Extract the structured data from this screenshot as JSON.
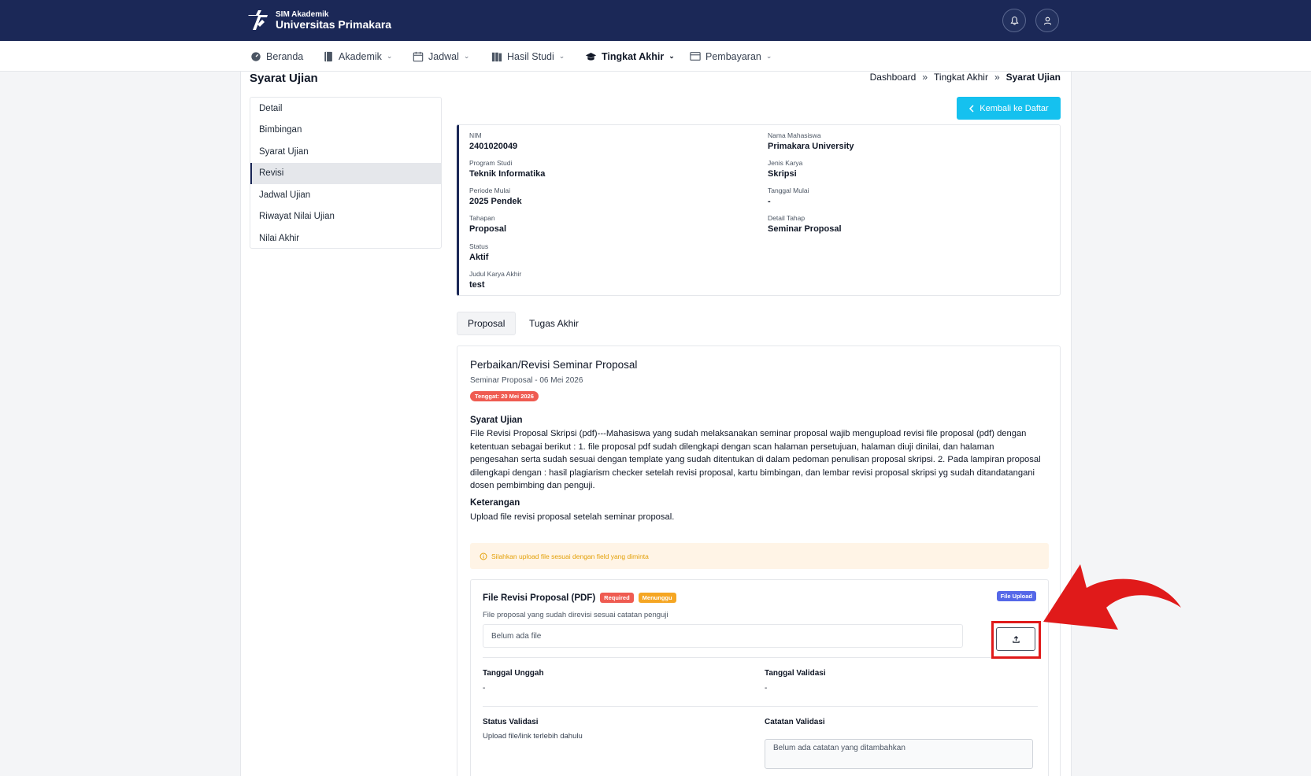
{
  "brand": {
    "subtitle": "SIM Akademik",
    "title": "Universitas Primakara"
  },
  "header_icons": [
    "bell-icon",
    "user-icon"
  ],
  "nav": [
    {
      "label": "Beranda",
      "icon": "dashboard-icon",
      "dropdown": false
    },
    {
      "label": "Akademik",
      "icon": "book-icon",
      "dropdown": true
    },
    {
      "label": "Jadwal",
      "icon": "calendar-icon",
      "dropdown": true
    },
    {
      "label": "Hasil Studi",
      "icon": "books-icon",
      "dropdown": true
    },
    {
      "label": "Tingkat Akhir",
      "icon": "graduation-cap-icon",
      "dropdown": true,
      "active": true
    },
    {
      "label": "Pembayaran",
      "icon": "wallet-icon",
      "dropdown": true
    }
  ],
  "page": {
    "title": "Syarat Ujian",
    "breadcrumb": [
      "Dashboard",
      "Tingkat Akhir",
      "Syarat Ujian"
    ],
    "breadcrumb_sep": "»",
    "back_button": "Kembali ke Daftar"
  },
  "side_menu": [
    "Detail",
    "Bimbingan",
    "Syarat Ujian",
    "Revisi",
    "Jadwal Ujian",
    "Riwayat Nilai Ujian",
    "Nilai Akhir"
  ],
  "side_menu_active": "Revisi",
  "info": {
    "nim": {
      "label": "NIM",
      "value": "2401020049"
    },
    "nama": {
      "label": "Nama Mahasiswa",
      "value": "Primakara University"
    },
    "prodi": {
      "label": "Program Studi",
      "value": "Teknik Informatika"
    },
    "jenis": {
      "label": "Jenis Karya",
      "value": "Skripsi"
    },
    "periode": {
      "label": "Periode Mulai",
      "value": "2025 Pendek"
    },
    "tanggal_mulai": {
      "label": "Tanggal Mulai",
      "value": "-"
    },
    "tahapan": {
      "label": "Tahapan",
      "value": "Proposal"
    },
    "detail_tahap": {
      "label": "Detail Tahap",
      "value": "Seminar Proposal"
    },
    "status": {
      "label": "Status",
      "value": "Aktif"
    },
    "judul": {
      "label": "Judul Karya Akhir",
      "value": "test"
    }
  },
  "tabs": [
    "Proposal",
    "Tugas Akhir"
  ],
  "active_tab": "Proposal",
  "revisi": {
    "title": "Perbaikan/Revisi Seminar Proposal",
    "subtitle": "Seminar Proposal - 06 Mei 2026",
    "deadline": "Tenggat: 20 Mei 2026",
    "syarat_heading": "Syarat Ujian",
    "syarat_text": "File Revisi Proposal Skripsi (pdf)---Mahasiswa yang sudah melaksanakan seminar proposal wajib mengupload revisi file proposal (pdf) dengan ketentuan sebagai berikut : 1. file proposal pdf sudah dilengkapi dengan scan halaman persetujuan, halaman diuji dinilai, dan halaman pengesahan serta sudah sesuai dengan template yang sudah ditentukan di dalam pedoman penulisan proposal skripsi. 2. Pada lampiran proposal dilengkapi dengan : hasil plagiarism checker setelah revisi proposal, kartu bimbingan, dan lembar revisi proposal skripsi yg sudah ditandatangani dosen pembimbing dan penguji.",
    "keterangan_heading": "Keterangan",
    "keterangan_text": "Upload file revisi proposal setelah seminar proposal.",
    "alert": "Silahkan upload file sesuai dengan field yang diminta"
  },
  "upload": {
    "title": "File Revisi Proposal (PDF)",
    "badge_required": "Required",
    "badge_status": "Menunggu",
    "badge_type": "File Upload",
    "description": "File proposal yang sudah direvisi sesuai catatan penguji",
    "file_placeholder": "Belum ada file",
    "tanggal_unggah_label": "Tanggal Unggah",
    "tanggal_unggah_value": "-",
    "tanggal_validasi_label": "Tanggal Validasi",
    "tanggal_validasi_value": "-",
    "status_validasi_label": "Status Validasi",
    "status_validasi_value": "Upload file/link terlebih dahulu",
    "catatan_label": "Catatan Validasi",
    "catatan_placeholder": "Belum ada catatan yang ditambahkan"
  },
  "colors": {
    "navy": "#1b2857",
    "cyan_button": "#15c1ef",
    "badge_red": "#ef5b51",
    "badge_orange": "#f5a623",
    "badge_blue": "#5568e8",
    "annotation_red": "#e01a1a"
  }
}
